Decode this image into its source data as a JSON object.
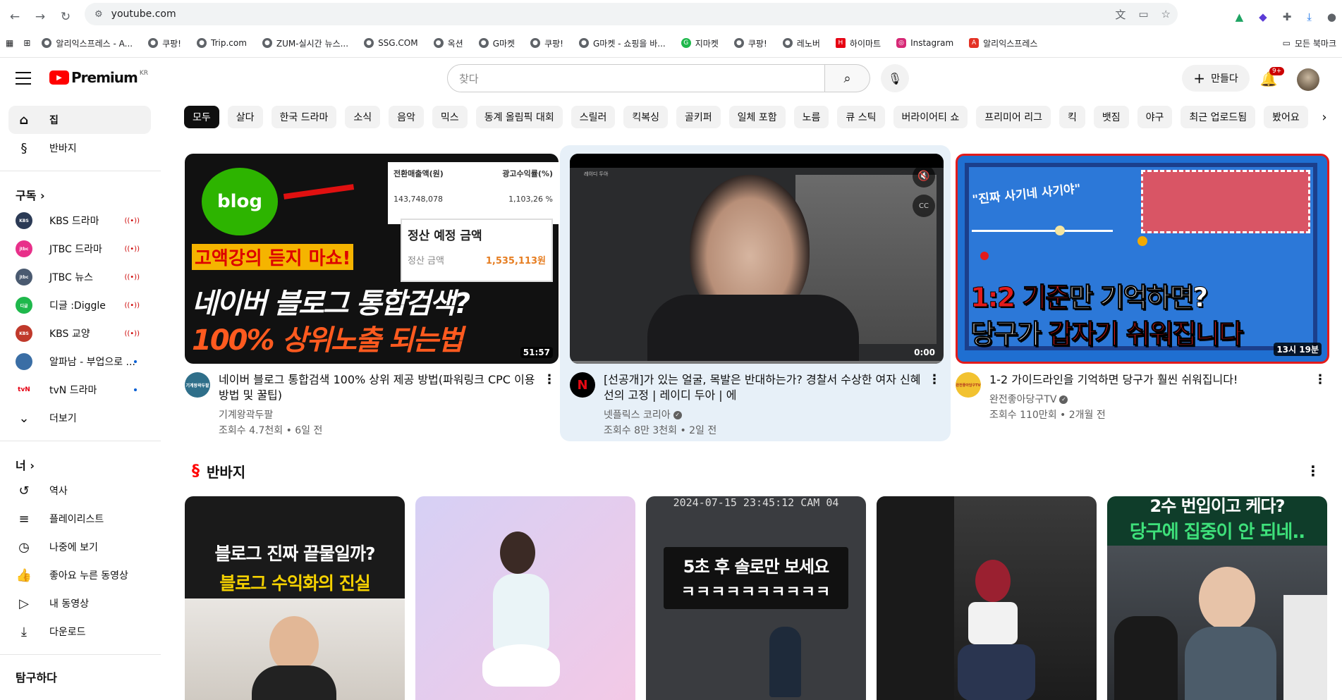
{
  "browser": {
    "url": "youtube.com",
    "bookmarks": [
      "알리익스프레스 - A...",
      "쿠팡!",
      "Trip.com",
      "ZUM-실시간 뉴스...",
      "SSG.COM",
      "옥션",
      "G마켓",
      "쿠팡!",
      "G마켓 - 쇼핑을 바...",
      "지마켓",
      "쿠팡!",
      "레노버",
      "하이마트",
      "Instagram",
      "알리익스프레스"
    ],
    "all_bookmarks": "모든 북마크"
  },
  "header": {
    "logo": "Premium",
    "logo_region": "KR",
    "search_placeholder": "찾다",
    "create_label": "만들다",
    "notif_count": "9+"
  },
  "sidebar": {
    "home": "집",
    "shorts": "반바지",
    "subs_header": "구독",
    "channels": [
      {
        "name": "KBS 드라마",
        "live": true,
        "color": "#2b3a55",
        "abbr": "KBS"
      },
      {
        "name": "JTBC 드라마",
        "live": true,
        "color": "#e8308a",
        "abbr": "jtbc"
      },
      {
        "name": "JTBC 뉴스",
        "live": true,
        "color": "#4a5a70",
        "abbr": "jtbc"
      },
      {
        "name": "디글 :Diggle",
        "live": true,
        "color": "#1fb84c",
        "abbr": "디글"
      },
      {
        "name": "KBS 교양",
        "live": true,
        "color": "#c0392b",
        "abbr": "KBS"
      },
      {
        "name": "알파남 - 부업으로 ...",
        "live": false,
        "color": "#3a6ea5",
        "abbr": ""
      },
      {
        "name": "tvN 드라마",
        "live": false,
        "color": "#e60012",
        "abbr": "tvN"
      }
    ],
    "more": "더보기",
    "you_header": "너",
    "you_items": [
      "역사",
      "플레이리스트",
      "나중에 보기",
      "좋아요 누른 동영상",
      "내 동영상",
      "다운로드"
    ],
    "explore_header": "탐구하다"
  },
  "chips": [
    "모두",
    "살다",
    "한국 드라마",
    "소식",
    "음악",
    "믹스",
    "동계 올림픽 대회",
    "스릴러",
    "킥복싱",
    "골키퍼",
    "일체 포함",
    "노름",
    "큐 스틱",
    "버라이어티 쇼",
    "프리미어 리그",
    "킥",
    "뱃짐",
    "야구",
    "최근 업로드됨",
    "봤어요"
  ],
  "videos": [
    {
      "title": "네이버 블로그 통합검색 100% 상위 제공 방법(파워링크 CPC 이용 방법 및 꿀팁)",
      "channel": "기계왕곽두팔",
      "stats": "조회수 4.7천회 • 6일 전",
      "duration": "51:57",
      "thumb_logo": "blog",
      "thumb_col1": "전환매출액(원)",
      "thumb_col2": "광고수익률(%)",
      "thumb_val1": "143,748,078",
      "thumb_val2": "1,103,26 %",
      "thumb_box_title": "정산 예정 금액",
      "thumb_box_label": "정산 금액",
      "thumb_box_value": "1,535,113원",
      "thumb_line1": "고액강의 듣지 마쇼!",
      "thumb_line2": "네이버 블로그 통합검색?",
      "thumb_line3": "100% 상위노출 되는법",
      "ch_abbr": "기계왕곽두팔"
    },
    {
      "title": "[선공개]가 있는 얼굴, 목발은 반대하는가? 경찰서 수상한 여자 신혜선의 고정 | 레이디 두아 | 에",
      "channel": "넷플릭스 코리아",
      "stats": "조회수 8만 3천회 • 2일 전",
      "duration": "0:00",
      "ch_abbr": "N",
      "tag": "레이디 두아"
    },
    {
      "title": "1-2 가이드라인을 기억하면 당구가 훨씬 쉬워집니다!",
      "channel": "완전좋아당구TV",
      "stats": "조회수 110만회 • 2개월 전",
      "duration": "13시 19분",
      "thumb_quote": "\"진짜 사기네 사기야\"",
      "thumb_line1a": "1:2 기준",
      "thumb_line1b": "만 기억하면?",
      "thumb_line2a": "당구가 ",
      "thumb_line2b": "갑자기 쉬워집니다",
      "ch_abbr": "완전좋아당구TV"
    }
  ],
  "shorts_header": "반바지",
  "shorts": [
    {
      "line1": "블로그 진짜 끝물일까?",
      "line2": "블로그 수익화의 진실"
    },
    {
      "line1": "",
      "line2": ""
    },
    {
      "line1": "5초 후 솔로만 보세요",
      "line2": "ㅋㅋㅋㅋㅋㅋㅋㅋㅋㅋ",
      "cam": "2024-07-15 23:45:12 CAM 04"
    },
    {
      "line1": "",
      "line2": ""
    },
    {
      "line1": "2수 번입이고 케다?",
      "line2": "당구에 집중이 안 되네.."
    }
  ],
  "colors": {
    "brand": "#ff0000",
    "live": "#cc0000",
    "highlight": "#e7f0f8"
  }
}
